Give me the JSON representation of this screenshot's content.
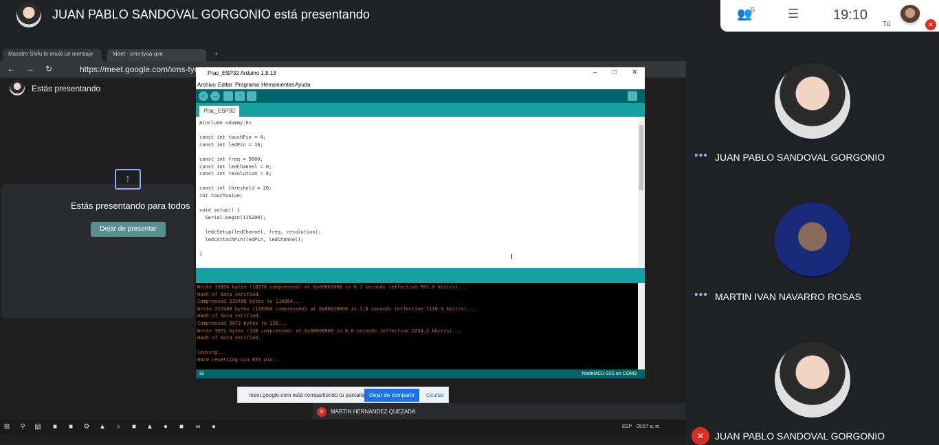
{
  "meet": {
    "presenter_title": "JUAN PABLO SANDOVAL GORGONIO está presentando",
    "people_count": "5",
    "clock": "19:10",
    "self_label": "Tú"
  },
  "browser": {
    "tabs": [
      {
        "label": "Maestro Shifu te envió un mensaje"
      },
      {
        "label": "Meet - xms-tyoa-qxe"
      }
    ],
    "url": "https://meet.google.com/xms-tyoa-qxe",
    "presenting_label": "Estás presentando"
  },
  "present_card": {
    "heading": "Estás presentando para todos",
    "stop_button": "Dejar de presentar"
  },
  "arduino": {
    "title": "Prac_ESP32 Arduino 1.8.13",
    "menu": [
      "Archivo",
      "Editar",
      "Programa",
      "Herramientas",
      "Ayuda"
    ],
    "tab": "Prac_ESP32",
    "code": "#include <dummy.h>\n\nconst int touchPin = 4;\nconst int ledPin = 16;\n\nconst int freq = 5000;\nconst int ledChannel = 0;\nconst int resolution = 8;\n\nconst int threshold = 20;\nint touchValue;\n\nvoid setup() {\n  Serial.begin(115200);\n\n  ledcSetup(ledChannel, freq, resolution);\n  ledcAttachPin(ledPin, ledChannel);\n\n}\n\n",
    "console": "Wrote 15856 bytes (10276 compressed) at 0x00001000 in 0.1 seconds (effective 991.0 kbit/s)...\nHash of data verified.\nCompressed 215488 bytes to 110364...\nWrote 215488 bytes (110364 compressed) at 0x00010000 in 1.6 seconds (effective 1110.9 kbit/s)...\nHash of data verified.\nCompressed 3072 bytes to 128...\nWrote 3072 bytes (128 compressed) at 0x00008000 in 0.0 seconds (effective 2234.2 kbit/s)...\nHash of data verified.\n\nLeaving...\nHard resetting via RTS pin...",
    "line_number": "18",
    "board": "NodeMCU-32S en COM3"
  },
  "share_banner": {
    "text": "meet.google.com está compartiendo tu pantalla.",
    "stop_button": "Dejar de compartir",
    "hide_link": "Ocultar"
  },
  "strip": {
    "name": "MARTIN HERNANDEZ QUEZADA"
  },
  "taskbar": {
    "lang": "ESP",
    "time": "05:57 a. m."
  },
  "participants": [
    {
      "name": "JUAN PABLO SANDOVAL GORGONIO"
    },
    {
      "name": "MARTIN IVAN NAVARRO ROSAS"
    },
    {
      "name": "JUAN PABLO SANDOVAL GORGONIO"
    }
  ],
  "icons": {
    "people": "people-icon",
    "chat": "chat-icon",
    "mic_off": "mic-off-icon",
    "present": "present-upload-icon"
  }
}
